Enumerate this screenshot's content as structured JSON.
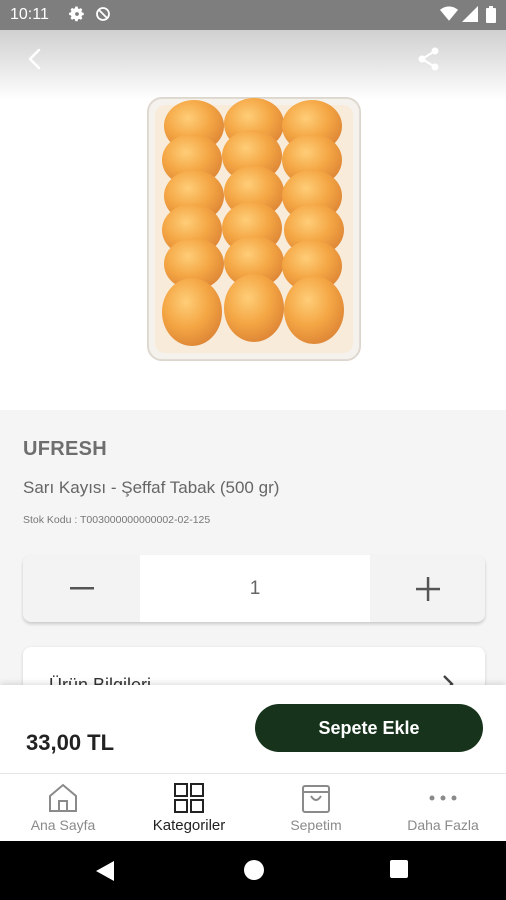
{
  "status_bar": {
    "time": "10:11",
    "icons": [
      "gear-icon",
      "sync-off-icon",
      "wifi-icon",
      "cell-signal-icon",
      "battery-icon"
    ]
  },
  "top_bar": {
    "icons": [
      "back-arrow-icon",
      "share-icon"
    ]
  },
  "product": {
    "brand": "UFRESH",
    "name": "Sarı Kayısı - Şeffaf Tabak (500 gr)",
    "stock_label": "Stok Kodu : ",
    "stock_code": "T003000000000002-02-125",
    "quantity": "1",
    "info_label": "Ürün Bilgileri",
    "price": "33,00 TL"
  },
  "actions": {
    "add_to_cart": "Sepete Ekle"
  },
  "bottom_nav": {
    "items": [
      {
        "label": "Ana Sayfa",
        "icon": "home-icon"
      },
      {
        "label": "Kategoriler",
        "icon": "grid-icon"
      },
      {
        "label": "Sepetim",
        "icon": "shopping-bag-icon"
      },
      {
        "label": "Daha Fazla",
        "icon": "more-dots-icon"
      }
    ],
    "active": "Kategoriler"
  },
  "colors": {
    "accent": "#17331c",
    "status_bar": "#7e7e7e",
    "apricot": "#f29a2e"
  }
}
